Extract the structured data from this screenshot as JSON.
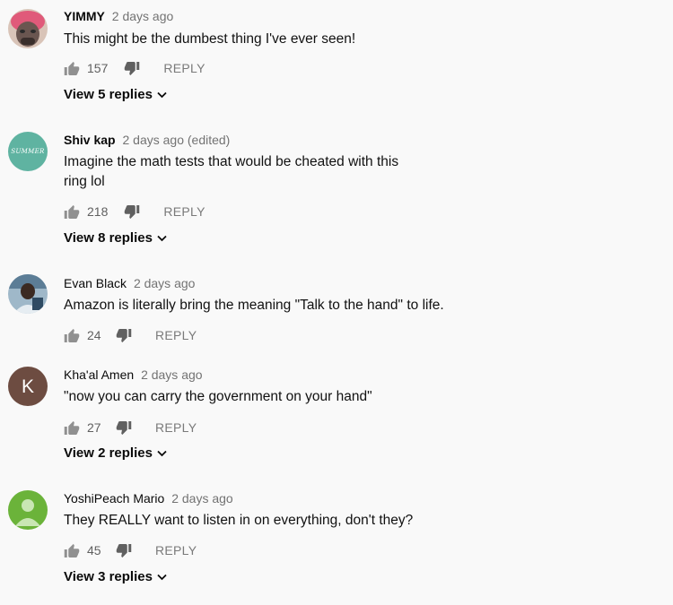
{
  "comments": [
    {
      "author": "YIMMY",
      "time": "2 days ago",
      "text": "This might be the dumbest thing I've ever seen!",
      "likes": "157",
      "reply": "REPLY",
      "view_replies": "View 5 replies"
    },
    {
      "author": "Shiv kap",
      "time": "2 days ago (edited)",
      "text": "Imagine the math tests that would be cheated with this ring lol",
      "likes": "218",
      "reply": "REPLY",
      "view_replies": "View 8 replies",
      "avatar_text": "SUMMER"
    },
    {
      "author": "Evan Black",
      "time": "2 days ago",
      "text": "Amazon is literally bring the meaning \"Talk to the hand\" to life.",
      "likes": "24",
      "reply": "REPLY"
    },
    {
      "author": "Kha'al Amen",
      "time": "2 days ago",
      "text": "\"now you can carry the government on your hand\"",
      "likes": "27",
      "reply": "REPLY",
      "view_replies": "View 2 replies",
      "avatar_letter": "K"
    },
    {
      "author": "YoshiPeach Mario",
      "time": "2 days ago",
      "text": "They REALLY want to listen in on everything, don't they?",
      "likes": "45",
      "reply": "REPLY",
      "view_replies": "View 3 replies"
    }
  ],
  "colors": {
    "avatar_summer": "#5fb3a1",
    "avatar_k": "#6d4c41",
    "avatar_default": "#6bb33a"
  }
}
